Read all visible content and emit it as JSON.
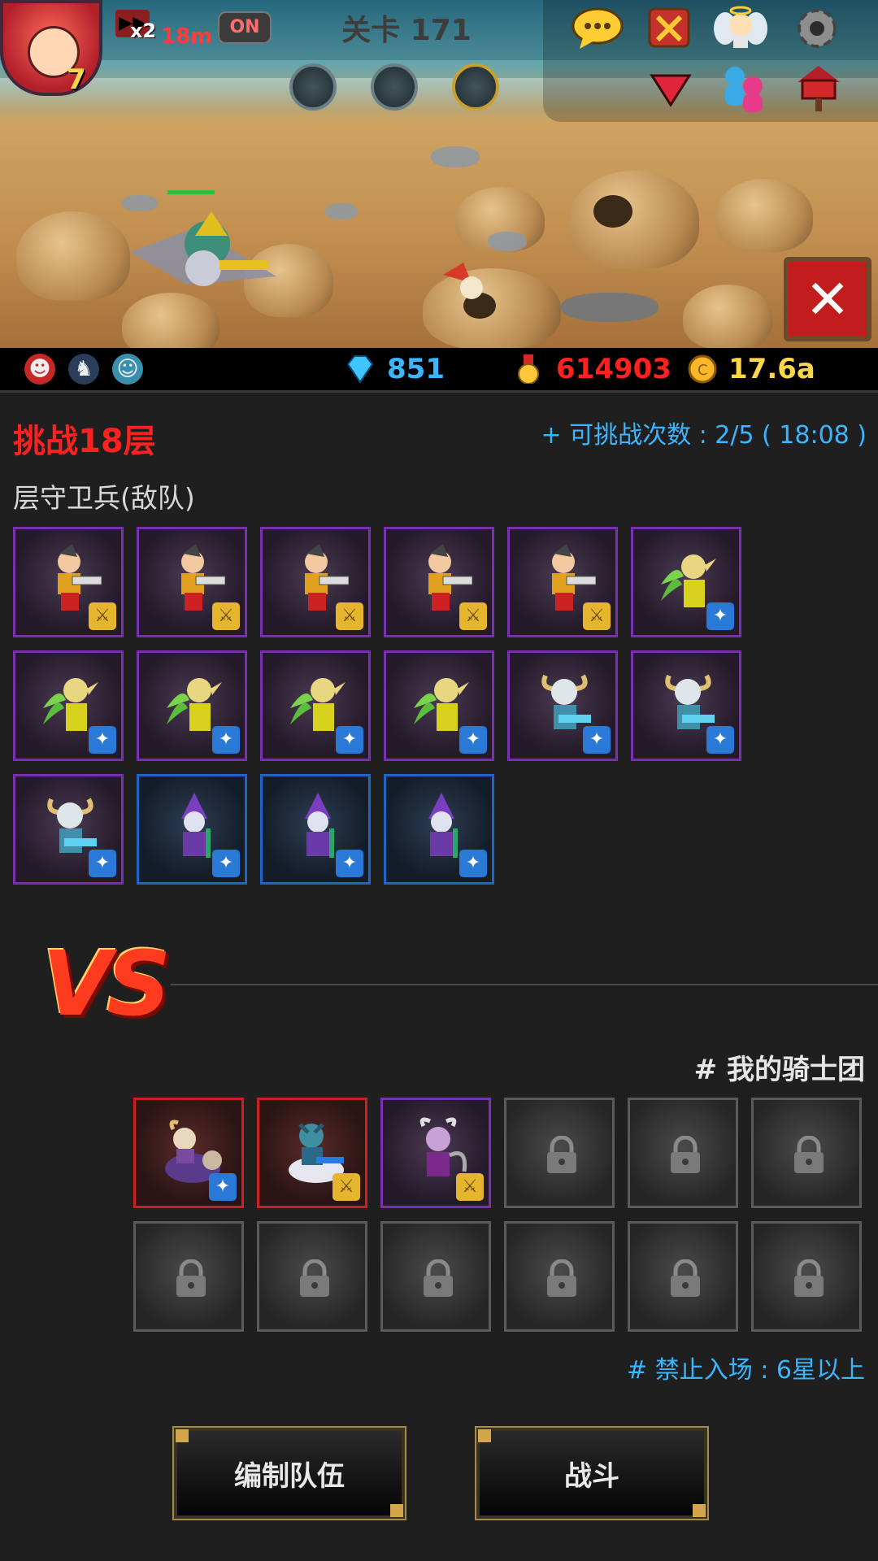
{
  "hud": {
    "avatar_level": "7",
    "speed_label": "x2",
    "timer": "18m",
    "toggle_label": "ON",
    "stage_title": "关卡 171"
  },
  "icons": {
    "top_right": [
      "chat-icon",
      "crossed-swords-icon",
      "angel-icon",
      "gear-icon"
    ],
    "second_row": [
      "down-arrow-icon",
      "friends-icon",
      "mailbox-icon"
    ],
    "skills": [
      "skill-icon-1",
      "skill-icon-2",
      "skill-icon-3"
    ],
    "close": "✕"
  },
  "resources": {
    "diamonds": "851",
    "medals": "614903",
    "gold": "17.6a",
    "colors": {
      "diamonds": "#39b6ff",
      "medals": "#ff2020",
      "gold": "#ffd54a"
    }
  },
  "challenge": {
    "title": "挑战18层",
    "attempts": "+ 可挑战次数 : 2/5 ( 18:08 )",
    "enemy_label": "层守卫兵(敌队)"
  },
  "enemy_slots": [
    {
      "unit": "gunner",
      "frame": "purple",
      "badge": "sword"
    },
    {
      "unit": "gunner",
      "frame": "purple",
      "badge": "sword"
    },
    {
      "unit": "gunner",
      "frame": "purple",
      "badge": "sword"
    },
    {
      "unit": "gunner",
      "frame": "purple",
      "badge": "sword"
    },
    {
      "unit": "gunner",
      "frame": "purple",
      "badge": "sword"
    },
    {
      "unit": "elf",
      "frame": "purple",
      "badge": "staff"
    },
    {
      "unit": "elf",
      "frame": "purple",
      "badge": "staff"
    },
    {
      "unit": "elf",
      "frame": "purple",
      "badge": "staff"
    },
    {
      "unit": "elf",
      "frame": "purple",
      "badge": "staff"
    },
    {
      "unit": "elf",
      "frame": "purple",
      "badge": "staff"
    },
    {
      "unit": "viking",
      "frame": "purple",
      "badge": "staff"
    },
    {
      "unit": "viking",
      "frame": "purple",
      "badge": "staff"
    },
    {
      "unit": "viking",
      "frame": "purple",
      "badge": "staff"
    },
    {
      "unit": "mage",
      "frame": "blue",
      "badge": "staff"
    },
    {
      "unit": "mage",
      "frame": "blue",
      "badge": "staff"
    },
    {
      "unit": "mage",
      "frame": "blue",
      "badge": "staff"
    }
  ],
  "vs_label": "VS",
  "my_team": {
    "label": "# 我的骑士团",
    "slots": [
      {
        "unit": "bull-rider",
        "frame": "red",
        "badge": "staff"
      },
      {
        "unit": "wolf-rider",
        "frame": "red",
        "badge": "sword"
      },
      {
        "unit": "demon",
        "frame": "purple",
        "badge": "sword"
      },
      {
        "unit": "locked",
        "frame": "locked"
      },
      {
        "unit": "locked",
        "frame": "locked"
      },
      {
        "unit": "locked",
        "frame": "locked"
      },
      {
        "unit": "locked",
        "frame": "locked"
      },
      {
        "unit": "locked",
        "frame": "locked"
      },
      {
        "unit": "locked",
        "frame": "locked"
      },
      {
        "unit": "locked",
        "frame": "locked"
      },
      {
        "unit": "locked",
        "frame": "locked"
      },
      {
        "unit": "locked",
        "frame": "locked"
      }
    ],
    "restriction": "# 禁止入场 : 6星以上"
  },
  "buttons": {
    "edit_team": "编制队伍",
    "fight": "战斗"
  }
}
